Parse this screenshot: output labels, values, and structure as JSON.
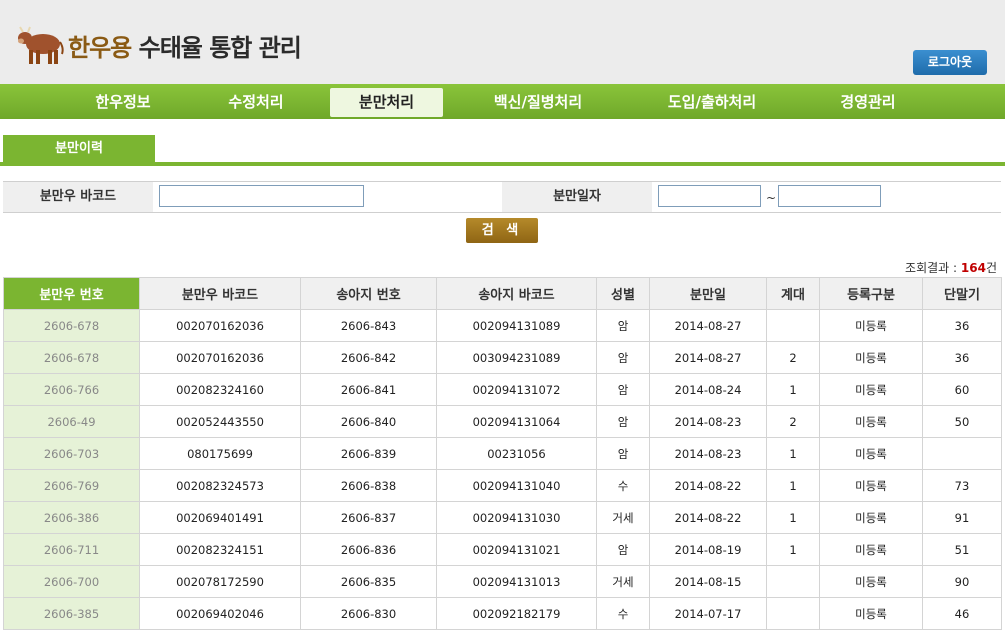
{
  "header": {
    "title_part1": "한우용",
    "title_part2": "수태율 통합 관리",
    "logout_label": "로그아웃",
    "logo_icon": "cow-icon"
  },
  "nav": {
    "items": [
      {
        "label": "한우정보"
      },
      {
        "label": "수정처리"
      },
      {
        "label": "분만처리"
      },
      {
        "label": "백신/질병처리"
      },
      {
        "label": "도입/출하처리"
      },
      {
        "label": "경영관리"
      }
    ],
    "active": "분만처리"
  },
  "subnav": {
    "tab_label": "분만이력"
  },
  "search": {
    "barcode_label": "분만우 바코드",
    "barcode_value": "",
    "date_label": "분만일자",
    "date_from": "",
    "date_to": "",
    "tilde": "~",
    "button_label": "검 색"
  },
  "result": {
    "label": "조회결과 : ",
    "count": "164",
    "unit": "건"
  },
  "table": {
    "headers": [
      "분만우 번호",
      "분만우 바코드",
      "송아지 번호",
      "송아지 바코드",
      "성별",
      "분만일",
      "계대",
      "등록구분",
      "단말기"
    ],
    "rows": [
      [
        "2606-678",
        "002070162036",
        "2606-843",
        "002094131089",
        "암",
        "2014-08-27",
        "",
        "미등록",
        "36"
      ],
      [
        "2606-678",
        "002070162036",
        "2606-842",
        "003094231089",
        "암",
        "2014-08-27",
        "2",
        "미등록",
        "36"
      ],
      [
        "2606-766",
        "002082324160",
        "2606-841",
        "002094131072",
        "암",
        "2014-08-24",
        "1",
        "미등록",
        "60"
      ],
      [
        "2606-49",
        "002052443550",
        "2606-840",
        "002094131064",
        "암",
        "2014-08-23",
        "2",
        "미등록",
        "50"
      ],
      [
        "2606-703",
        "080175699",
        "2606-839",
        "00231056",
        "암",
        "2014-08-23",
        "1",
        "미등록",
        ""
      ],
      [
        "2606-769",
        "002082324573",
        "2606-838",
        "002094131040",
        "수",
        "2014-08-22",
        "1",
        "미등록",
        "73"
      ],
      [
        "2606-386",
        "002069401491",
        "2606-837",
        "002094131030",
        "거세",
        "2014-08-22",
        "1",
        "미등록",
        "91"
      ],
      [
        "2606-711",
        "002082324151",
        "2606-836",
        "002094131021",
        "암",
        "2014-08-19",
        "1",
        "미등록",
        "51"
      ],
      [
        "2606-700",
        "002078172590",
        "2606-835",
        "002094131013",
        "거세",
        "2014-08-15",
        "",
        "미등록",
        "90"
      ],
      [
        "2606-385",
        "002069402046",
        "2606-830",
        "002092182179",
        "수",
        "2014-07-17",
        "",
        "미등록",
        "46"
      ]
    ]
  },
  "colors": {
    "nav_green": "#7bb531",
    "button_brown": "#8f6514",
    "logout_blue": "#1f6cab",
    "count_red": "#c00000"
  }
}
